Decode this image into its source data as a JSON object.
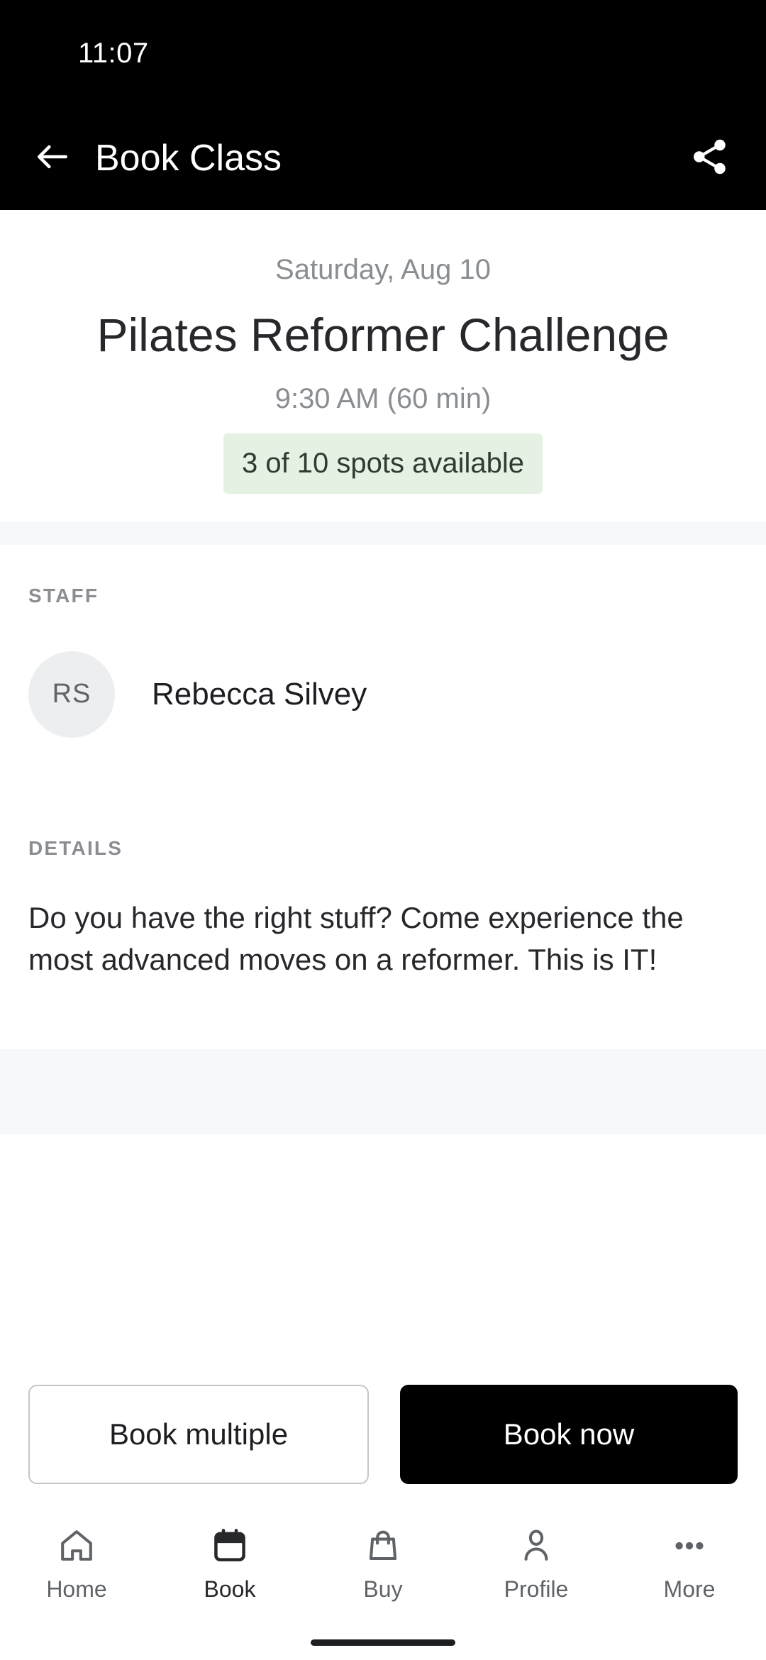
{
  "status_bar": {
    "time": "11:07"
  },
  "app_bar": {
    "title": "Book Class",
    "back_icon": "arrow-left-icon",
    "share_icon": "share-icon"
  },
  "class": {
    "date": "Saturday, Aug 10",
    "title": "Pilates Reformer Challenge",
    "time": "9:30 AM (60 min)",
    "availability": "3 of 10 spots available",
    "availability_bg": "#e4f1e3",
    "availability_text_color": "#2f3b30"
  },
  "staff_section": {
    "label": "STAFF",
    "avatar_initials": "RS",
    "name": "Rebecca Silvey"
  },
  "details_section": {
    "label": "DETAILS",
    "text": "Do you have the right stuff? Come experience the most advanced moves on a reformer. This is IT!"
  },
  "actions": {
    "secondary_label": "Book multiple",
    "primary_label": "Book now"
  },
  "bottom_nav": {
    "items": [
      {
        "label": "Home",
        "icon": "home-icon",
        "active": false
      },
      {
        "label": "Book",
        "icon": "calendar-icon",
        "active": true
      },
      {
        "label": "Buy",
        "icon": "shopping-bag-icon",
        "active": false
      },
      {
        "label": "Profile",
        "icon": "person-icon",
        "active": false
      },
      {
        "label": "More",
        "icon": "more-dots-icon",
        "active": false
      }
    ]
  },
  "colors": {
    "header_bg": "#000000",
    "page_bg": "#ffffff",
    "divider": "#f6f8fa",
    "muted_text": "#8a8d91",
    "primary_text": "#26282b",
    "accent": "#000000"
  }
}
